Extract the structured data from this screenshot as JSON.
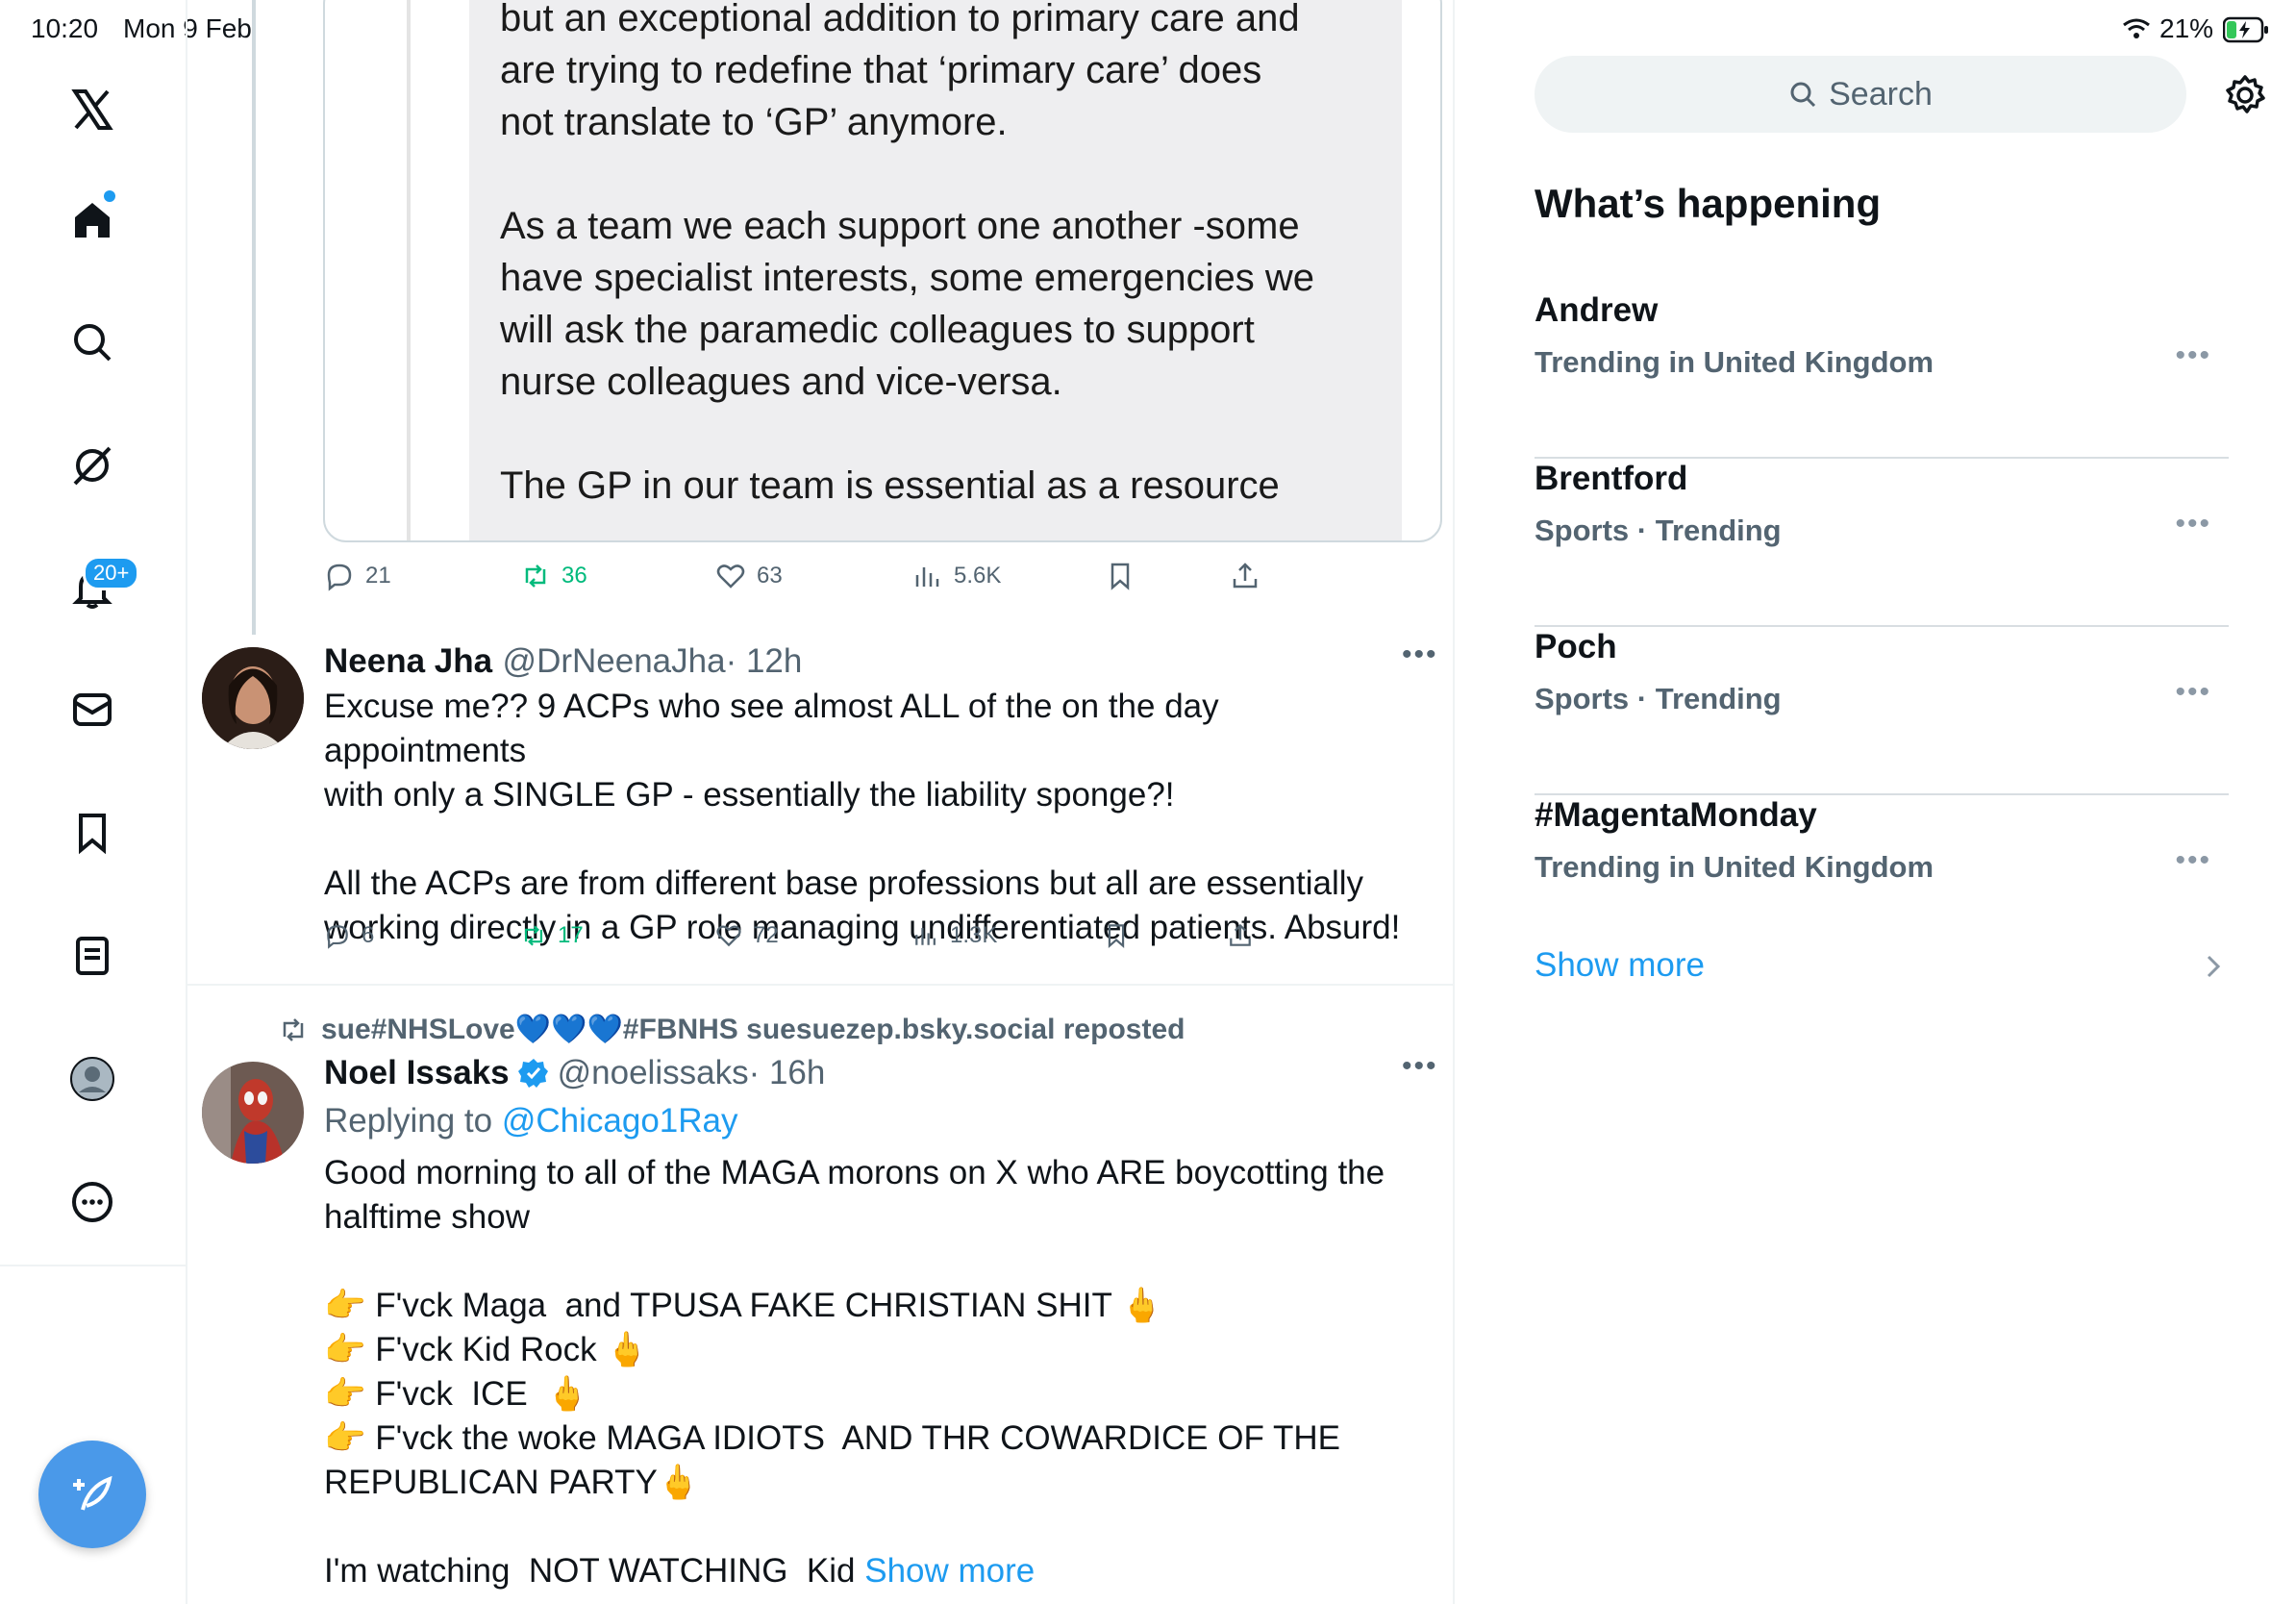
{
  "status_bar": {
    "time": "10:20",
    "date": "Mon 9 Feb",
    "battery": "21%"
  },
  "nav": {
    "notifications_badge": "20+"
  },
  "quoted_tweet": {
    "text": "but an exceptional addition to primary care and\nare trying to redefine that ‘primary care’ does\nnot translate to ‘GP’ anymore.\n\nAs a team we each support one another -some\nhave specialist interests, some emergencies we\nwill ask the paramedic colleagues to support\nnurse colleagues and vice-versa.\n\nThe GP in our team is essential as a resource",
    "actions": {
      "replies": "21",
      "reposts": "36",
      "likes": "63",
      "views": "5.6K"
    }
  },
  "tweet1": {
    "name": "Neena Jha",
    "handle": "@DrNeenaJha",
    "time": "· 12h",
    "text": "Excuse me?? 9 ACPs who see almost ALL of the on the day appointments\nwith only a SINGLE GP - essentially the liability sponge?!\n\nAll the ACPs are from different base professions but all are essentially\nworking directly in a GP role managing undifferentiated patients. Absurd!",
    "actions": {
      "replies": "6",
      "reposts": "17",
      "likes": "72",
      "views": "1.3K"
    }
  },
  "tweet2": {
    "repost_line": "sue#NHSLove💙💙💙#FBNHS suesuezep.bsky.social reposted",
    "name": "Noel Issaks",
    "handle": "@noelissaks",
    "time": "· 16h",
    "replying_label": "Replying to",
    "replying_to": "@Chicago1Ray",
    "text": "Good morning to all of the MAGA morons on X who ARE boycotting the\nhalftime show\n\n👉 F'vck Maga  and TPUSA FAKE CHRISTIAN SHIT 🖕\n👉 F'vck Kid Rock 🖕\n👉 F'vck  ICE  🖕\n👉 F'vck the woke MAGA IDIOTS  AND THR COWARDICE OF THE\nREPUBLICAN PARTY🖕\n\nI'm watching  NOT WATCHING  Kid ",
    "show_more": "Show more"
  },
  "sidebar": {
    "search_placeholder": "Search",
    "title": "What’s happening",
    "trends": [
      {
        "name": "Andrew",
        "meta": "Trending in United Kingdom"
      },
      {
        "name": "Brentford",
        "meta": "Sports · Trending"
      },
      {
        "name": "Poch",
        "meta": "Sports · Trending"
      },
      {
        "name": "#MagentaMonday",
        "meta": "Trending in United Kingdom"
      }
    ],
    "show_more": "Show more"
  },
  "colors": {
    "accent": "#1d9bf0",
    "repost_green": "#00ba7c",
    "muted": "#536471"
  }
}
